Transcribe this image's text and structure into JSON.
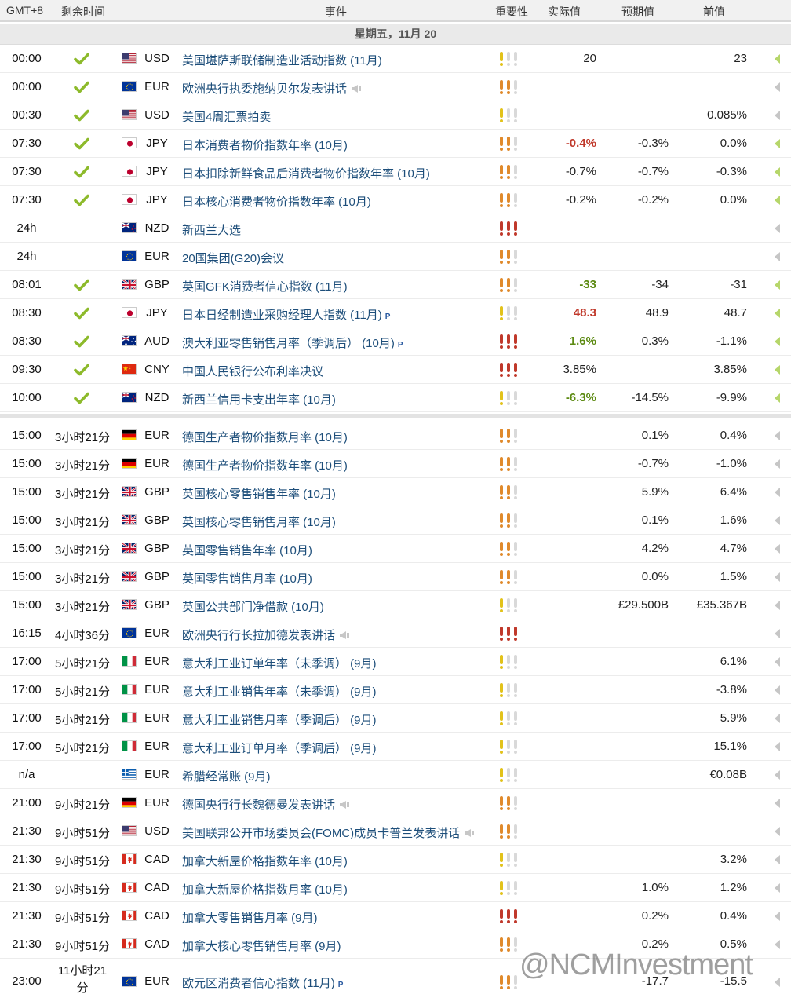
{
  "header": {
    "timezone": "GMT+8",
    "remaining": "剩余时间",
    "event": "事件",
    "importance": "重要性",
    "actual": "实际值",
    "forecast": "预期值",
    "previous": "前值"
  },
  "date_label": "星期五，11月 20",
  "colors": {
    "high": "#c0392b",
    "medium": "#e08a2c",
    "low": "#e2c21a",
    "green_value": "#5c8a12",
    "red_value": "#c0392b"
  },
  "rows": [
    {
      "time": "00:00",
      "left": "",
      "done": true,
      "flag": "us-flag",
      "currency": "USD",
      "event": "美国堪萨斯联储制造业活动指数 (11月)",
      "speech": false,
      "p": false,
      "importance": 1,
      "actual": "20",
      "actual_color": "",
      "forecast": "",
      "previous": "23",
      "arrow_green": true
    },
    {
      "time": "00:00",
      "left": "",
      "done": true,
      "flag": "eu-flag",
      "currency": "EUR",
      "event": "欧洲央行执委施纳贝尔发表讲话",
      "speech": true,
      "p": false,
      "importance": 2,
      "actual": "",
      "actual_color": "",
      "forecast": "",
      "previous": "",
      "arrow_green": false
    },
    {
      "time": "00:30",
      "left": "",
      "done": true,
      "flag": "us-flag",
      "currency": "USD",
      "event": "美国4周汇票拍卖",
      "speech": false,
      "p": false,
      "importance": 1,
      "actual": "",
      "actual_color": "",
      "forecast": "",
      "previous": "0.085%",
      "arrow_green": false
    },
    {
      "time": "07:30",
      "left": "",
      "done": true,
      "flag": "jp-flag",
      "currency": "JPY",
      "event": "日本消费者物价指数年率 (10月)",
      "speech": false,
      "p": false,
      "importance": 2,
      "actual": "-0.4%",
      "actual_color": "red",
      "forecast": "-0.3%",
      "previous": "0.0%",
      "arrow_green": true
    },
    {
      "time": "07:30",
      "left": "",
      "done": true,
      "flag": "jp-flag",
      "currency": "JPY",
      "event": "日本扣除新鲜食品后消费者物价指数年率 (10月)",
      "speech": false,
      "p": false,
      "importance": 2,
      "actual": "-0.7%",
      "actual_color": "",
      "forecast": "-0.7%",
      "previous": "-0.3%",
      "arrow_green": true
    },
    {
      "time": "07:30",
      "left": "",
      "done": true,
      "flag": "jp-flag",
      "currency": "JPY",
      "event": "日本核心消费者物价指数年率 (10月)",
      "speech": false,
      "p": false,
      "importance": 2,
      "actual": "-0.2%",
      "actual_color": "",
      "forecast": "-0.2%",
      "previous": "0.0%",
      "arrow_green": true
    },
    {
      "time": "24h",
      "left": "",
      "done": false,
      "flag": "nz-flag",
      "currency": "NZD",
      "event": "新西兰大选",
      "speech": false,
      "p": false,
      "importance": 3,
      "actual": "",
      "actual_color": "",
      "forecast": "",
      "previous": "",
      "arrow_green": false
    },
    {
      "time": "24h",
      "left": "",
      "done": false,
      "flag": "eu-flag",
      "currency": "EUR",
      "event": "20国集团(G20)会议",
      "speech": false,
      "p": false,
      "importance": 2,
      "actual": "",
      "actual_color": "",
      "forecast": "",
      "previous": "",
      "arrow_green": false
    },
    {
      "time": "08:01",
      "left": "",
      "done": true,
      "flag": "gb-flag",
      "currency": "GBP",
      "event": "英国GFK消费者信心指数 (11月)",
      "speech": false,
      "p": false,
      "importance": 2,
      "actual": "-33",
      "actual_color": "green",
      "forecast": "-34",
      "previous": "-31",
      "arrow_green": true
    },
    {
      "time": "08:30",
      "left": "",
      "done": true,
      "flag": "jp-flag",
      "currency": "JPY",
      "event": "日本日经制造业采购经理人指数 (11月)",
      "speech": false,
      "p": true,
      "importance": 1,
      "actual": "48.3",
      "actual_color": "red",
      "forecast": "48.9",
      "previous": "48.7",
      "arrow_green": true
    },
    {
      "time": "08:30",
      "left": "",
      "done": true,
      "flag": "au-flag",
      "currency": "AUD",
      "event": "澳大利亚零售销售月率（季调后） (10月)",
      "speech": false,
      "p": true,
      "importance": 3,
      "actual": "1.6%",
      "actual_color": "green",
      "forecast": "0.3%",
      "previous": "-1.1%",
      "arrow_green": true
    },
    {
      "time": "09:30",
      "left": "",
      "done": true,
      "flag": "cn-flag",
      "currency": "CNY",
      "event": "中国人民银行公布利率决议",
      "speech": false,
      "p": false,
      "importance": 3,
      "actual": "3.85%",
      "actual_color": "",
      "forecast": "",
      "previous": "3.85%",
      "arrow_green": true
    },
    {
      "time": "10:00",
      "left": "",
      "done": true,
      "flag": "nz-flag",
      "currency": "NZD",
      "event": "新西兰信用卡支出年率 (10月)",
      "speech": false,
      "p": false,
      "importance": 1,
      "actual": "-6.3%",
      "actual_color": "green",
      "forecast": "-14.5%",
      "previous": "-9.9%",
      "arrow_green": true
    },
    {
      "time": "15:00",
      "left": "3小时21分",
      "done": false,
      "flag": "de-flag",
      "currency": "EUR",
      "event": "德国生产者物价指数月率 (10月)",
      "speech": false,
      "p": false,
      "importance": 2,
      "actual": "",
      "actual_color": "",
      "forecast": "0.1%",
      "previous": "0.4%",
      "arrow_green": false
    },
    {
      "time": "15:00",
      "left": "3小时21分",
      "done": false,
      "flag": "de-flag",
      "currency": "EUR",
      "event": "德国生产者物价指数年率 (10月)",
      "speech": false,
      "p": false,
      "importance": 2,
      "actual": "",
      "actual_color": "",
      "forecast": "-0.7%",
      "previous": "-1.0%",
      "arrow_green": false
    },
    {
      "time": "15:00",
      "left": "3小时21分",
      "done": false,
      "flag": "gb-flag",
      "currency": "GBP",
      "event": "英国核心零售销售年率 (10月)",
      "speech": false,
      "p": false,
      "importance": 2,
      "actual": "",
      "actual_color": "",
      "forecast": "5.9%",
      "previous": "6.4%",
      "arrow_green": false
    },
    {
      "time": "15:00",
      "left": "3小时21分",
      "done": false,
      "flag": "gb-flag",
      "currency": "GBP",
      "event": "英国核心零售销售月率 (10月)",
      "speech": false,
      "p": false,
      "importance": 2,
      "actual": "",
      "actual_color": "",
      "forecast": "0.1%",
      "previous": "1.6%",
      "arrow_green": false
    },
    {
      "time": "15:00",
      "left": "3小时21分",
      "done": false,
      "flag": "gb-flag",
      "currency": "GBP",
      "event": "英国零售销售年率 (10月)",
      "speech": false,
      "p": false,
      "importance": 2,
      "actual": "",
      "actual_color": "",
      "forecast": "4.2%",
      "previous": "4.7%",
      "arrow_green": false
    },
    {
      "time": "15:00",
      "left": "3小时21分",
      "done": false,
      "flag": "gb-flag",
      "currency": "GBP",
      "event": "英国零售销售月率 (10月)",
      "speech": false,
      "p": false,
      "importance": 2,
      "actual": "",
      "actual_color": "",
      "forecast": "0.0%",
      "previous": "1.5%",
      "arrow_green": false
    },
    {
      "time": "15:00",
      "left": "3小时21分",
      "done": false,
      "flag": "gb-flag",
      "currency": "GBP",
      "event": "英国公共部门净借款 (10月)",
      "speech": false,
      "p": false,
      "importance": 1,
      "actual": "",
      "actual_color": "",
      "forecast": "£29.500B",
      "previous": "£35.367B",
      "arrow_green": false
    },
    {
      "time": "16:15",
      "left": "4小时36分",
      "done": false,
      "flag": "eu-flag",
      "currency": "EUR",
      "event": "欧洲央行行长拉加德发表讲话",
      "speech": true,
      "p": false,
      "importance": 3,
      "actual": "",
      "actual_color": "",
      "forecast": "",
      "previous": "",
      "arrow_green": false
    },
    {
      "time": "17:00",
      "left": "5小时21分",
      "done": false,
      "flag": "it-flag",
      "currency": "EUR",
      "event": "意大利工业订单年率（未季调） (9月)",
      "speech": false,
      "p": false,
      "importance": 1,
      "actual": "",
      "actual_color": "",
      "forecast": "",
      "previous": "6.1%",
      "arrow_green": false
    },
    {
      "time": "17:00",
      "left": "5小时21分",
      "done": false,
      "flag": "it-flag",
      "currency": "EUR",
      "event": "意大利工业销售年率（未季调） (9月)",
      "speech": false,
      "p": false,
      "importance": 1,
      "actual": "",
      "actual_color": "",
      "forecast": "",
      "previous": "-3.8%",
      "arrow_green": false
    },
    {
      "time": "17:00",
      "left": "5小时21分",
      "done": false,
      "flag": "it-flag",
      "currency": "EUR",
      "event": "意大利工业销售月率（季调后） (9月)",
      "speech": false,
      "p": false,
      "importance": 1,
      "actual": "",
      "actual_color": "",
      "forecast": "",
      "previous": "5.9%",
      "arrow_green": false
    },
    {
      "time": "17:00",
      "left": "5小时21分",
      "done": false,
      "flag": "it-flag",
      "currency": "EUR",
      "event": "意大利工业订单月率（季调后） (9月)",
      "speech": false,
      "p": false,
      "importance": 1,
      "actual": "",
      "actual_color": "",
      "forecast": "",
      "previous": "15.1%",
      "arrow_green": false
    },
    {
      "time": "n/a",
      "left": "",
      "done": false,
      "flag": "gr-flag",
      "currency": "EUR",
      "event": "希腊经常账 (9月)",
      "speech": false,
      "p": false,
      "importance": 1,
      "actual": "",
      "actual_color": "",
      "forecast": "",
      "previous": "€0.08B",
      "arrow_green": false
    },
    {
      "time": "21:00",
      "left": "9小时21分",
      "done": false,
      "flag": "de-flag",
      "currency": "EUR",
      "event": "德国央行行长魏德曼发表讲话",
      "speech": true,
      "p": false,
      "importance": 2,
      "actual": "",
      "actual_color": "",
      "forecast": "",
      "previous": "",
      "arrow_green": false
    },
    {
      "time": "21:30",
      "left": "9小时51分",
      "done": false,
      "flag": "us-flag",
      "currency": "USD",
      "event": "美国联邦公开市场委员会(FOMC)成员卡普兰发表讲话",
      "speech": true,
      "p": false,
      "importance": 2,
      "actual": "",
      "actual_color": "",
      "forecast": "",
      "previous": "",
      "arrow_green": false
    },
    {
      "time": "21:30",
      "left": "9小时51分",
      "done": false,
      "flag": "ca-flag",
      "currency": "CAD",
      "event": "加拿大新屋价格指数年率 (10月)",
      "speech": false,
      "p": false,
      "importance": 1,
      "actual": "",
      "actual_color": "",
      "forecast": "",
      "previous": "3.2%",
      "arrow_green": false
    },
    {
      "time": "21:30",
      "left": "9小时51分",
      "done": false,
      "flag": "ca-flag",
      "currency": "CAD",
      "event": "加拿大新屋价格指数月率 (10月)",
      "speech": false,
      "p": false,
      "importance": 1,
      "actual": "",
      "actual_color": "",
      "forecast": "1.0%",
      "previous": "1.2%",
      "arrow_green": false
    },
    {
      "time": "21:30",
      "left": "9小时51分",
      "done": false,
      "flag": "ca-flag",
      "currency": "CAD",
      "event": "加拿大零售销售月率 (9月)",
      "speech": false,
      "p": false,
      "importance": 3,
      "actual": "",
      "actual_color": "",
      "forecast": "0.2%",
      "previous": "0.4%",
      "arrow_green": false
    },
    {
      "time": "21:30",
      "left": "9小时51分",
      "done": false,
      "flag": "ca-flag",
      "currency": "CAD",
      "event": "加拿大核心零售销售月率 (9月)",
      "speech": false,
      "p": false,
      "importance": 2,
      "actual": "",
      "actual_color": "",
      "forecast": "0.2%",
      "previous": "0.5%",
      "arrow_green": false
    },
    {
      "time": "23:00",
      "left": "11小时21 分",
      "done": false,
      "flag": "eu-flag",
      "currency": "EUR",
      "event": "欧元区消费者信心指数 (11月)",
      "speech": false,
      "p": true,
      "importance": 2,
      "actual": "",
      "actual_color": "",
      "forecast": "-17.7",
      "previous": "-15.5",
      "arrow_green": false
    }
  ],
  "p_marker": "P",
  "watermark": "@NCMInvestment"
}
